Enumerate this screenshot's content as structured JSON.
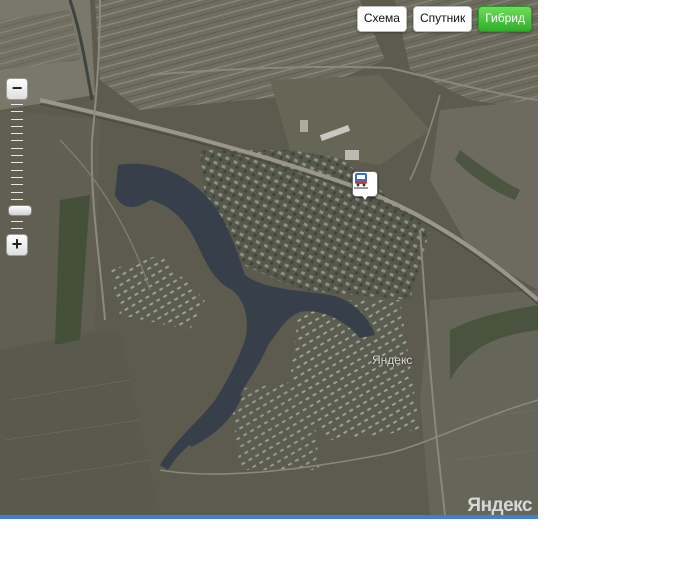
{
  "map_types": {
    "scheme": "Схема",
    "satellite": "Спутник",
    "hybrid": "Гибрид",
    "active": "Гибрид"
  },
  "zoom": {
    "minus_label": "−",
    "plus_label": "+",
    "level_fraction": 0.86
  },
  "map": {
    "place_label": "Яндекс",
    "logo": "Яндекс",
    "marker_icon": "train-station-icon"
  }
}
